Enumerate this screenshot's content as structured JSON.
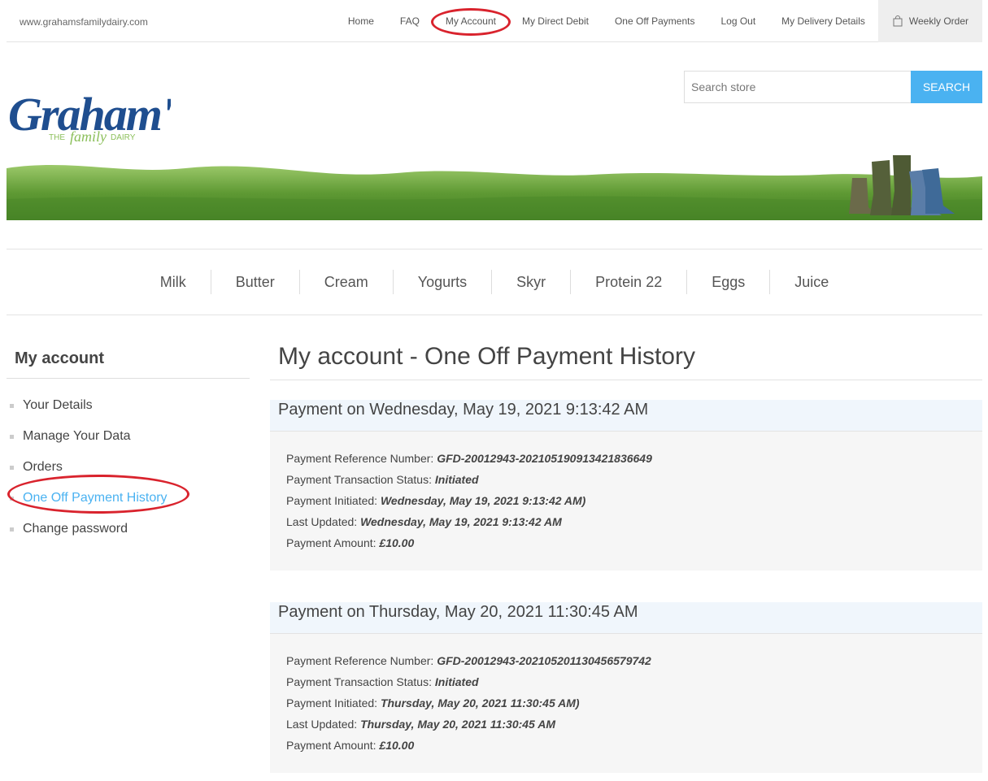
{
  "site_url": "www.grahamsfamilydairy.com",
  "topnav": {
    "links": [
      "Home",
      "FAQ",
      "My Account",
      "My Direct Debit",
      "One Off Payments",
      "Log Out",
      "My Delivery Details"
    ],
    "weekly_order": "Weekly Order"
  },
  "logo": {
    "brand": "Graham's",
    "tagline": "THE family DAIRY"
  },
  "search": {
    "placeholder": "Search store",
    "button": "Search"
  },
  "categories": [
    "Milk",
    "Butter",
    "Cream",
    "Yogurts",
    "Skyr",
    "Protein 22",
    "Eggs",
    "Juice"
  ],
  "sidebar": {
    "title": "My account",
    "items": [
      "Your Details",
      "Manage Your Data",
      "Orders",
      "One Off Payment History",
      "Change password"
    ],
    "active_index": 3
  },
  "page_title": "My account - One Off Payment History",
  "labels": {
    "ref": "Payment Reference Number:",
    "status": "Payment Transaction Status:",
    "initiated": "Payment Initiated:",
    "updated": "Last Updated:",
    "amount": "Payment Amount:"
  },
  "payments": [
    {
      "heading": "Payment on Wednesday, May 19, 2021 9:13:42 AM",
      "ref": "GFD-20012943-20210519091342183664​9",
      "status": "Initiated",
      "initiated": "Wednesday, May 19, 2021 9:13:42 AM)",
      "updated": "Wednesday, May 19, 2021 9:13:42 AM",
      "amount": "£10.00"
    },
    {
      "heading": "Payment on Thursday, May 20, 2021 11:30:45 AM",
      "ref": "GFD-20012943-20210520113045657974​2",
      "status": "Initiated",
      "initiated": "Thursday, May 20, 2021 11:30:45 AM)",
      "updated": "Thursday, May 20, 2021 11:30:45 AM",
      "amount": "£10.00"
    }
  ],
  "colors": {
    "accent": "#4ab2f1",
    "annotation": "#d9232d",
    "brand_blue": "#1f4e8f",
    "brand_green": "#8bbf5a"
  }
}
